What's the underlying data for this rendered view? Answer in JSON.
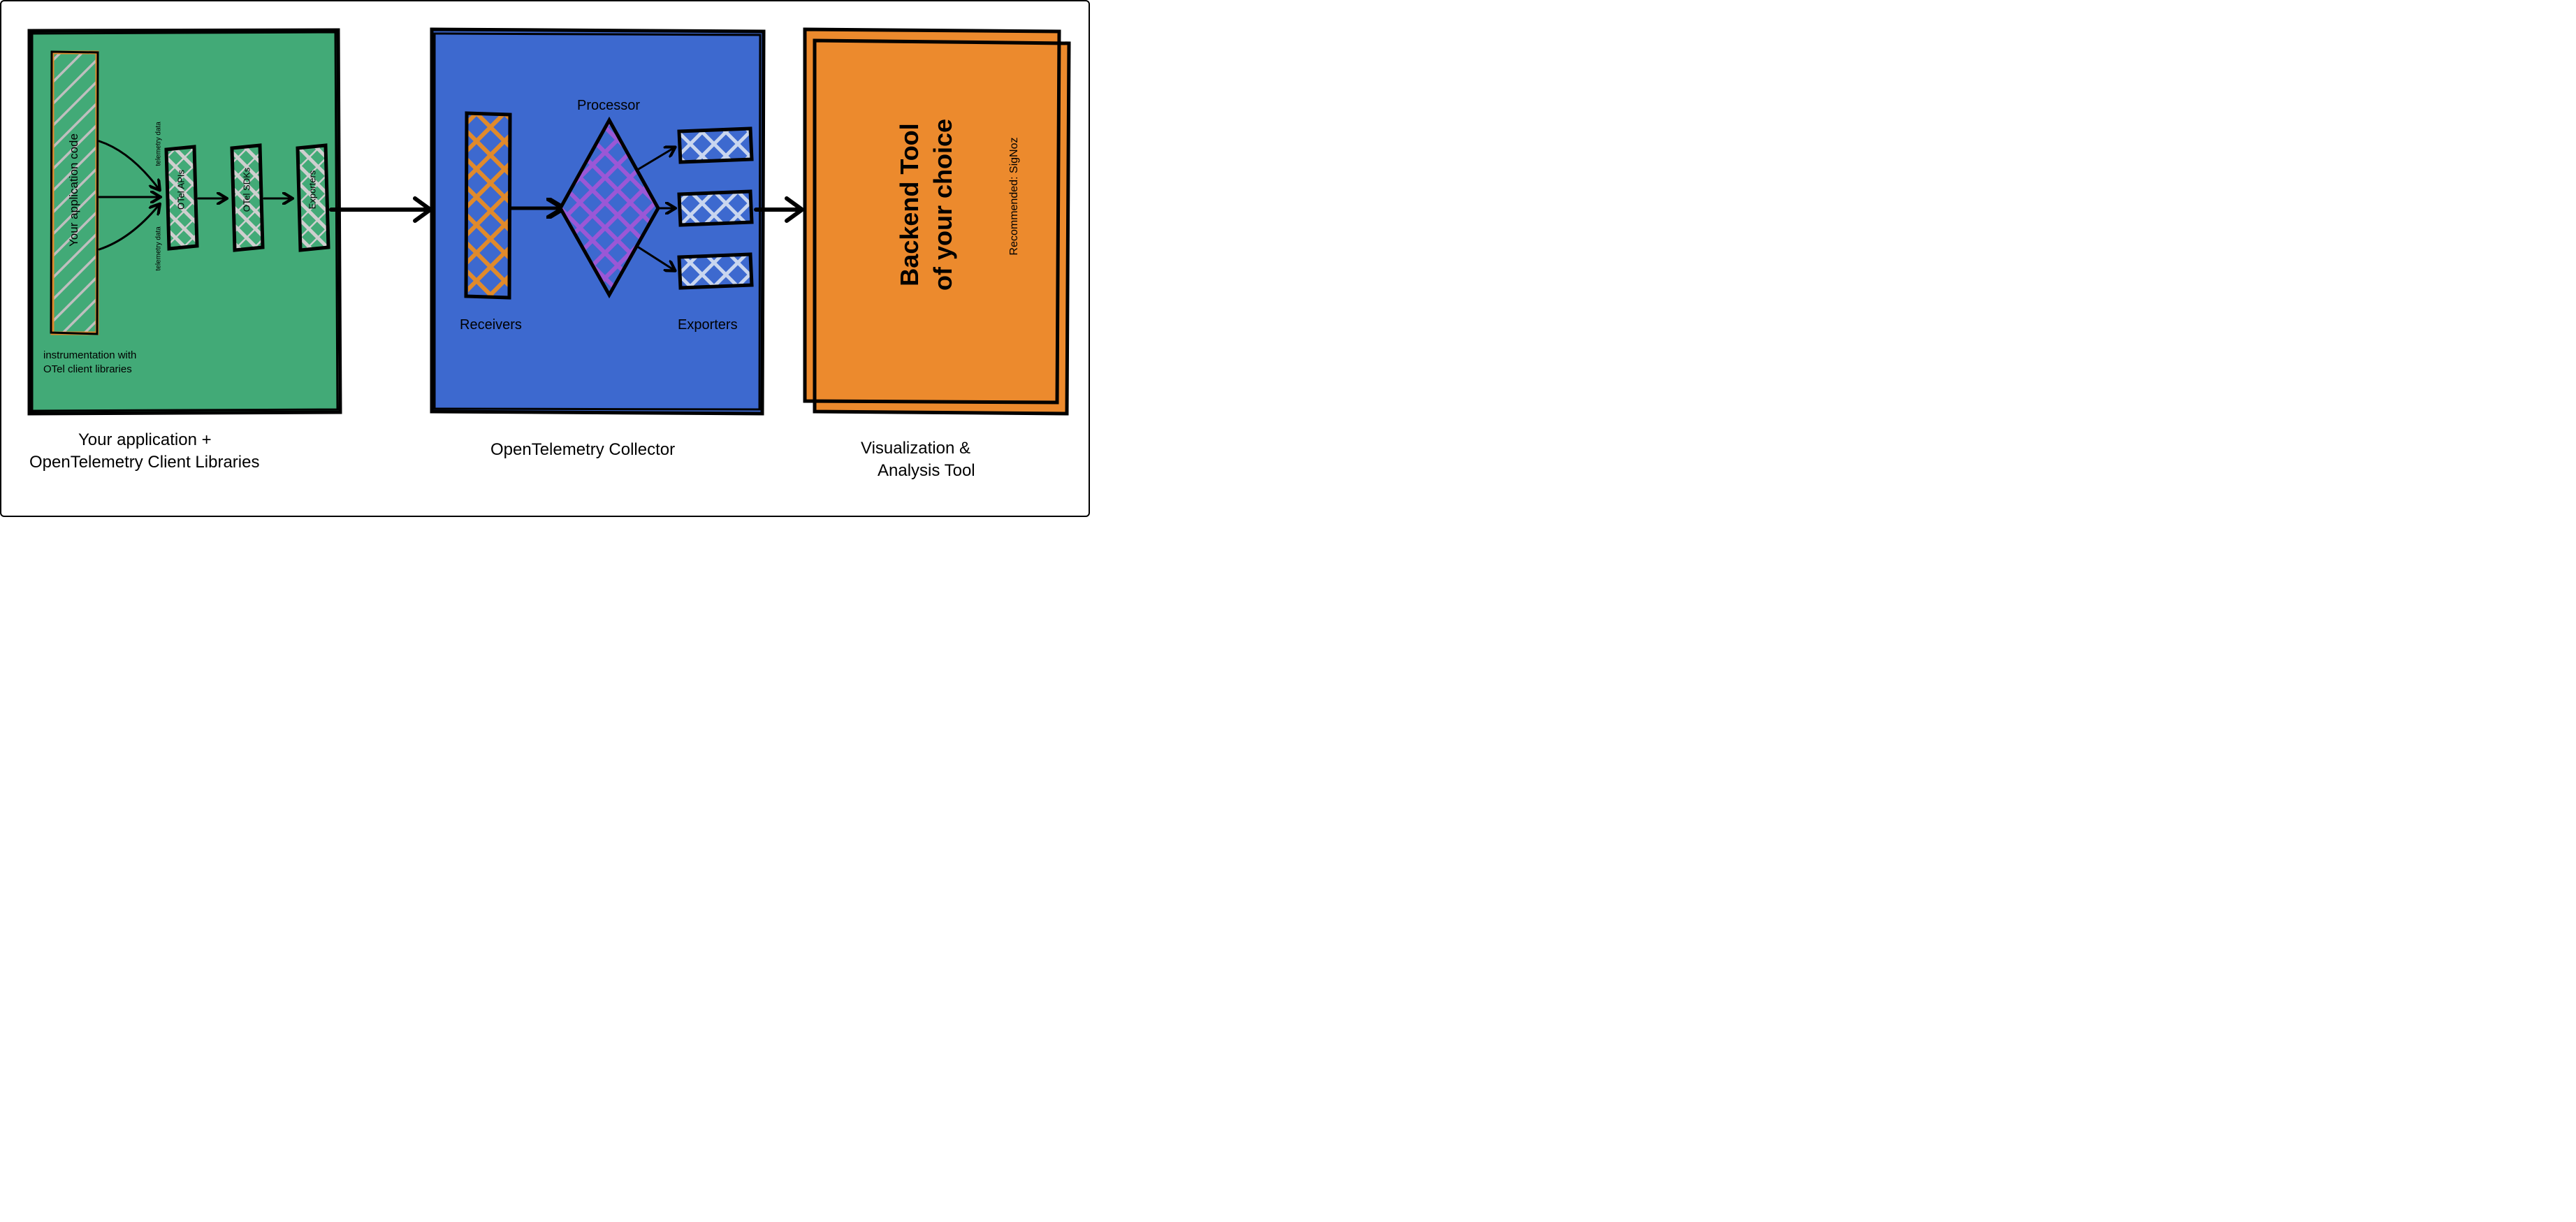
{
  "colors": {
    "green": "#42aa77",
    "blue": "#3d69cf",
    "orange": "#ec8a2d",
    "hatchLight": "#bfbfbf",
    "hatchOrange": "#e08a2b",
    "hatchPurple": "#9b57d6",
    "hatchWhite": "#c9d6ef"
  },
  "panel1": {
    "caption_line1": "Your application +",
    "caption_line2": "OpenTelemetry Client Libraries",
    "note_line1": "instrumentation with",
    "note_line2": "OTel client libraries",
    "appCode": "Your application code",
    "telemetry": "telemetry data",
    "apis": "OTel APIs",
    "sdks": "OTel SDKs",
    "exporters": "Exporters"
  },
  "panel2": {
    "caption": "OpenTelemetry Collector",
    "receivers": "Receivers",
    "processor": "Processor",
    "exporters": "Exporters"
  },
  "panel3": {
    "caption_line1": "Visualization &",
    "caption_line2": "Analysis Tool",
    "title_line1": "Backend Tool",
    "title_line2": "of your choice",
    "recommended": "Recommended: SigNoz"
  }
}
